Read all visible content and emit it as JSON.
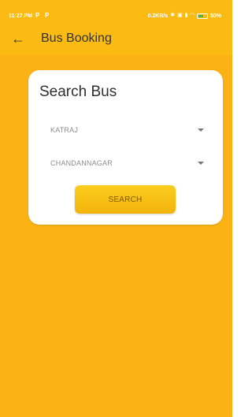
{
  "statusbar": {
    "time": "11:27 PM",
    "p_icon_1": "P",
    "p_icon_2": "P",
    "network_speed": "0.2KB/s",
    "battery": "50%"
  },
  "appbar": {
    "title": "Bus Booking",
    "back_icon": "←"
  },
  "card": {
    "title": "Search Bus",
    "from_value": "KATRAJ",
    "to_value": "CHANDANNAGAR",
    "button_label": "SEARCH"
  }
}
